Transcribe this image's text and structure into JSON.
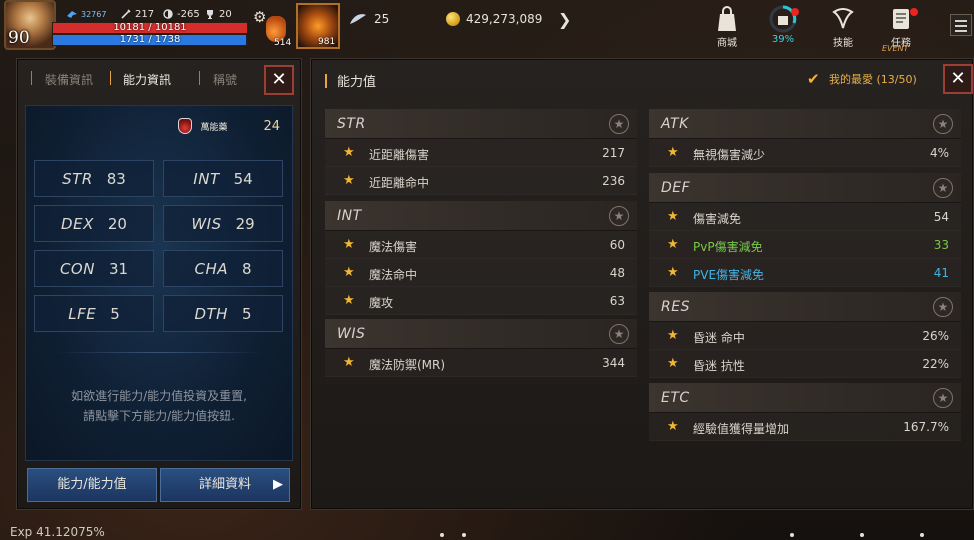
{
  "hud": {
    "level": "90",
    "combat_power": "32767",
    "stat_a": "217",
    "stat_b": "-265",
    "stat_c": "20",
    "hp_text": "10181 / 10181",
    "mp_text": "1731 / 1738",
    "hp_fraction": 1.0,
    "mp_fraction": 0.996,
    "potion_count": "514",
    "skill_count": "981",
    "feather_count": "25",
    "gold": "429,273,089",
    "menu": [
      {
        "label": "商城",
        "icon": "shop-bag-icon"
      },
      {
        "label": "39%",
        "icon": "gift-progress-icon"
      },
      {
        "label": "技能",
        "icon": "skill-icon"
      },
      {
        "label": "任務",
        "icon": "quest-scroll-icon"
      }
    ],
    "event_label": "EVENT"
  },
  "left_panel": {
    "tabs": [
      "裝備資訊",
      "能力資訊",
      "稱號"
    ],
    "active_tab": 1,
    "potion_name": "萬能藥",
    "potion_count": "24",
    "stats": [
      {
        "abbr": "STR",
        "value": "83"
      },
      {
        "abbr": "INT",
        "value": "54"
      },
      {
        "abbr": "DEX",
        "value": "20"
      },
      {
        "abbr": "WIS",
        "value": "29"
      },
      {
        "abbr": "CON",
        "value": "31"
      },
      {
        "abbr": "CHA",
        "value": "8"
      },
      {
        "abbr": "LFE",
        "value": "5"
      },
      {
        "abbr": "DTH",
        "value": "5"
      }
    ],
    "hint_line1": "如欲進行能力/能力值投資及重置,",
    "hint_line2": "請點擊下方能力/能力值按鈕.",
    "button_ability": "能力/能力值",
    "button_detail": "詳細資料"
  },
  "right_panel": {
    "title": "能力值",
    "favorites": "我的最愛 (13/50)",
    "left_sections": [
      {
        "title": "STR",
        "rows": [
          {
            "name": "近距離傷害",
            "value": "217"
          },
          {
            "name": "近距離命中",
            "value": "236"
          }
        ]
      },
      {
        "title": "INT",
        "rows": [
          {
            "name": "魔法傷害",
            "value": "60"
          },
          {
            "name": "魔法命中",
            "value": "48"
          },
          {
            "name": "魔攻",
            "value": "63"
          }
        ]
      },
      {
        "title": "WIS",
        "rows": [
          {
            "name": "魔法防禦(MR)",
            "value": "344"
          }
        ]
      }
    ],
    "right_sections": [
      {
        "title": "ATK",
        "rows": [
          {
            "name": "無視傷害減少",
            "value": "4%"
          }
        ]
      },
      {
        "title": "DEF",
        "rows": [
          {
            "name": "傷害減免",
            "value": "54"
          },
          {
            "name": "PvP傷害減免",
            "value": "33",
            "color": "green"
          },
          {
            "name": "PVE傷害減免",
            "value": "41",
            "color": "blue"
          }
        ]
      },
      {
        "title": "RES",
        "rows": [
          {
            "name": "昏迷 命中",
            "value": "26%"
          },
          {
            "name": "昏迷 抗性",
            "value": "22%"
          }
        ]
      },
      {
        "title": "ETC",
        "rows": [
          {
            "name": "經驗值獲得量增加",
            "value": "167.7%"
          }
        ]
      }
    ]
  },
  "footer": {
    "exp_text": "Exp 41.12075%"
  }
}
